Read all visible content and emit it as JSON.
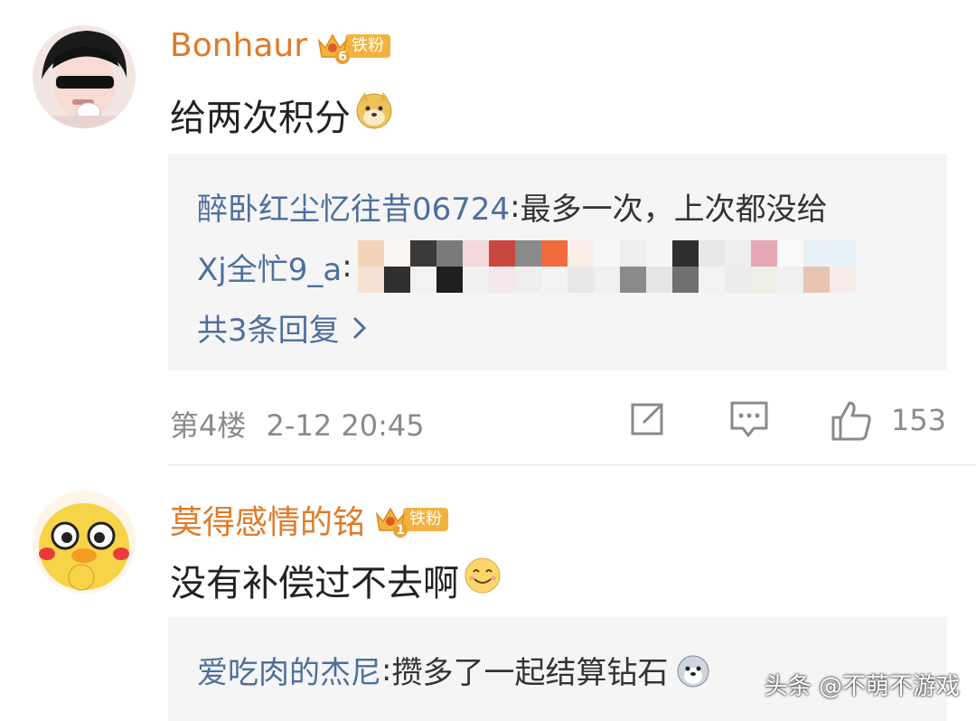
{
  "comments": [
    {
      "username": "Bonhaur",
      "fan_level": "6",
      "fan_label": "铁粉",
      "text": "给两次积分",
      "text_emoji": "doge-emoji",
      "replies": [
        {
          "name": "醉卧红尘忆往昔06724",
          "sep": ":",
          "text": " 最多一次，上次都没给"
        },
        {
          "name": "Xj全忙9_a",
          "sep": ":",
          "text": ""
        }
      ],
      "more_replies": "共3条回复",
      "floor": "第4楼",
      "time": "2-12 20:45",
      "like_count": "153"
    },
    {
      "username": "莫得感情的铭",
      "fan_level": "1",
      "fan_label": "铁粉",
      "text": "没有补偿过不去啊",
      "text_emoji": "smile-emoji",
      "replies": [
        {
          "name": "爱吃肉的杰尼",
          "sep": ":",
          "text": " 攒多了一起结算钻石"
        }
      ]
    }
  ],
  "watermark": "头条 @不萌不游戏",
  "colors": {
    "username": "#e07a28",
    "reply_name": "#4e6f9c",
    "meta": "#8a8a8a",
    "reply_bg": "#f5f5f6",
    "badge": "#f3b240"
  }
}
